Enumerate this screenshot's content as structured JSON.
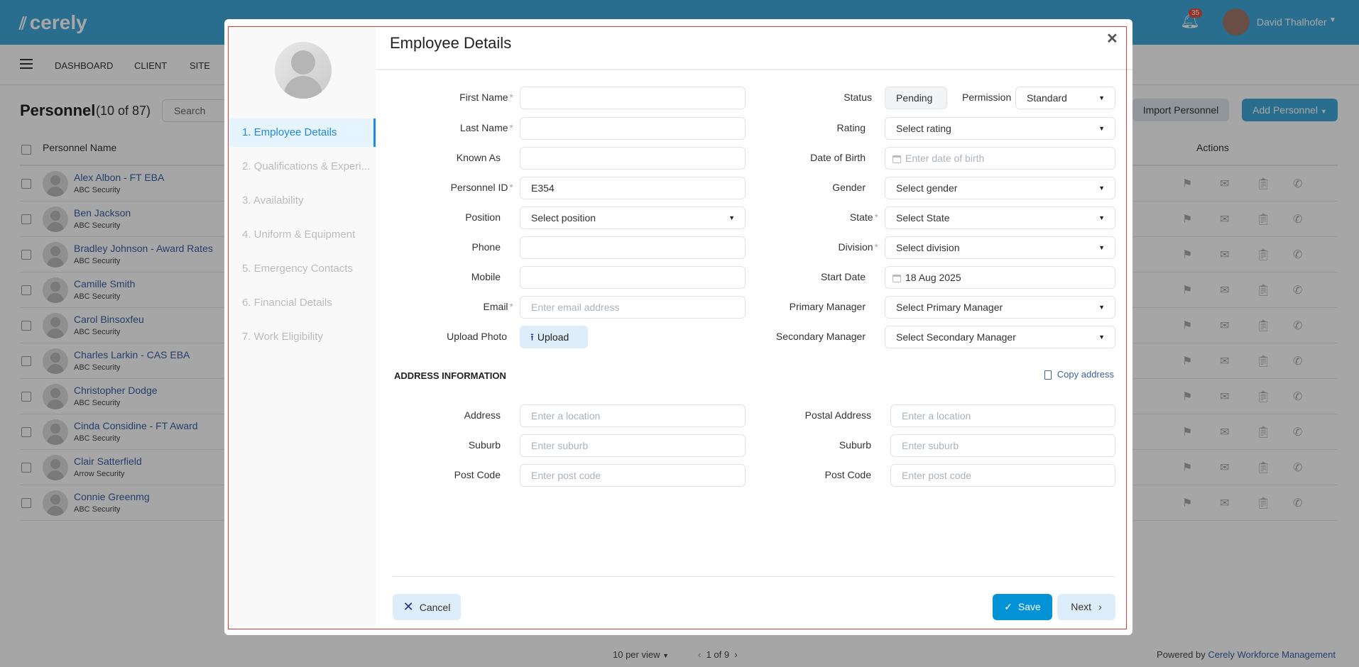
{
  "app": {
    "logo": "cerely",
    "notifications": "35",
    "user_name": "David Thalhofer"
  },
  "nav": {
    "items": [
      "DASHBOARD",
      "CLIENT",
      "SITE"
    ]
  },
  "page": {
    "title": "Personnel",
    "count": "(10 of 87)",
    "search_placeholder": "Search",
    "import_label": "Import Personnel",
    "add_label": "Add Personnel"
  },
  "table": {
    "headers": {
      "name": "Personnel Name",
      "actions": "Actions"
    },
    "rows": [
      {
        "name": "Alex Albon - FT EBA",
        "company": "ABC Security"
      },
      {
        "name": "Ben Jackson",
        "company": "ABC Security"
      },
      {
        "name": "Bradley Johnson - Award Rates",
        "company": "ABC Security"
      },
      {
        "name": "Camille Smith",
        "company": "ABC Security"
      },
      {
        "name": "Carol Binsoxfeu",
        "company": "ABC Security"
      },
      {
        "name": "Charles Larkin - CAS EBA",
        "company": "ABC Security"
      },
      {
        "name": "Christopher Dodge",
        "company": "ABC Security"
      },
      {
        "name": "Cinda Considine - FT Award",
        "company": "ABC Security"
      },
      {
        "name": "Clair Satterfield",
        "company": "Arrow Security"
      },
      {
        "name": "Connie Greenmg",
        "company": "ABC Security"
      }
    ]
  },
  "footer": {
    "per_view": "10 per view",
    "pages": "1 of 9",
    "powered_prefix": "Powered by",
    "powered_link": "Cerely Workforce Management"
  },
  "modal": {
    "title": "Employee Details",
    "steps": [
      "1. Employee Details",
      "2. Qualifications & Experi...",
      "3. Availability",
      "4. Uniform & Equipment",
      "5. Emergency Contacts",
      "6. Financial Details",
      "7. Work Eligibility"
    ],
    "left_fields": [
      {
        "label": "First Name",
        "required": "*",
        "value": "",
        "placeholder": "",
        "type": "text"
      },
      {
        "label": "Last Name",
        "required": "*",
        "value": "",
        "placeholder": "",
        "type": "text"
      },
      {
        "label": "Known As",
        "required": "",
        "value": "",
        "placeholder": "",
        "type": "text"
      },
      {
        "label": "Personnel ID",
        "required": "*",
        "value": "E354",
        "placeholder": "",
        "type": "text"
      },
      {
        "label": "Position",
        "required": "",
        "value": "Select position",
        "placeholder": "",
        "type": "select"
      },
      {
        "label": "Phone",
        "required": "",
        "value": "",
        "placeholder": "",
        "type": "text"
      },
      {
        "label": "Mobile",
        "required": "",
        "value": "",
        "placeholder": "",
        "type": "text"
      },
      {
        "label": "Email",
        "required": "*",
        "value": "",
        "placeholder": "Enter email address",
        "type": "text"
      }
    ],
    "upload": {
      "label": "Upload Photo",
      "button": "Upload"
    },
    "status": {
      "label": "Status",
      "value": "Pending",
      "permission_label": "Permission",
      "permission_value": "Standard"
    },
    "right_fields": [
      {
        "label": "Rating",
        "required": "",
        "value": "Select rating",
        "placeholder": "",
        "type": "select"
      },
      {
        "label": "Date of Birth",
        "required": "",
        "value": "",
        "placeholder": "Enter date of birth",
        "type": "date"
      },
      {
        "label": "Gender",
        "required": "",
        "value": "Select gender",
        "placeholder": "",
        "type": "select"
      },
      {
        "label": "State",
        "required": "*",
        "value": "Select State",
        "placeholder": "",
        "type": "select"
      },
      {
        "label": "Division",
        "required": "*",
        "value": "Select division",
        "placeholder": "",
        "type": "select"
      },
      {
        "label": "Start Date",
        "required": "",
        "value": "18 Aug 2025",
        "placeholder": "",
        "type": "date"
      },
      {
        "label": "Primary Manager",
        "required": "",
        "value": "Select Primary Manager",
        "placeholder": "",
        "type": "select"
      },
      {
        "label": "Secondary Manager",
        "required": "",
        "value": "Select Secondary Manager",
        "placeholder": "",
        "type": "select"
      }
    ],
    "address": {
      "heading": "ADDRESS INFORMATION",
      "copy_label": "Copy address",
      "left": [
        {
          "label": "Address",
          "placeholder": "Enter a location"
        },
        {
          "label": "Suburb",
          "placeholder": "Enter suburb"
        },
        {
          "label": "Post Code",
          "placeholder": "Enter post code"
        }
      ],
      "right": [
        {
          "label": "Postal Address",
          "placeholder": "Enter a location"
        },
        {
          "label": "Suburb",
          "placeholder": "Enter suburb"
        },
        {
          "label": "Post Code",
          "placeholder": "Enter post code"
        }
      ]
    },
    "buttons": {
      "cancel": "Cancel",
      "save": "Save",
      "next": "Next"
    }
  }
}
